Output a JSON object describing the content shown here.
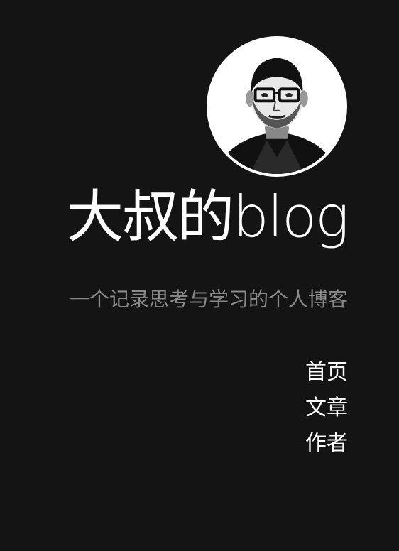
{
  "site": {
    "title": "大叔的blog",
    "tagline": "一个记录思考与学习的个人博客"
  },
  "avatar": {
    "icon": "person-portrait-icon"
  },
  "nav": {
    "items": [
      {
        "label": "首页"
      },
      {
        "label": "文章"
      },
      {
        "label": "作者"
      }
    ]
  },
  "colors": {
    "background": "#141414",
    "title": "#ffffff",
    "tagline": "#8a8a8a",
    "nav": "#ffffff"
  }
}
